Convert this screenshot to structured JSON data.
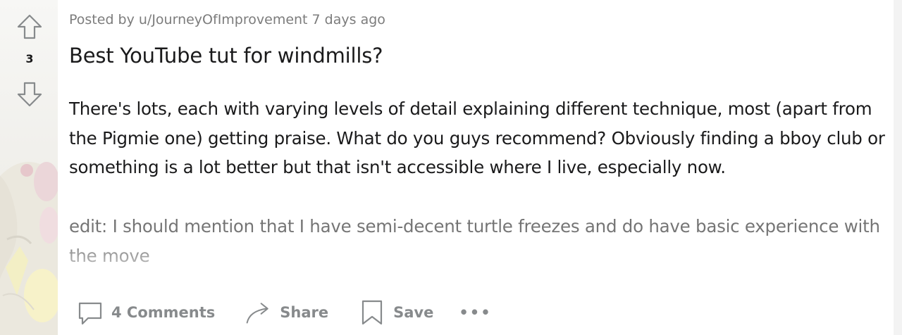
{
  "vote": {
    "score": "3",
    "upvote_icon": "arrow-up-outline-icon",
    "downvote_icon": "arrow-down-outline-icon"
  },
  "post": {
    "meta": "Posted by u/JourneyOfImprovement 7 days ago",
    "title": "Best YouTube tut for windmills?",
    "body": "There's lots, each with varying levels of detail explaining different technique, most (apart from the Pigmie one) getting praise. What do you guys recommend? Obviously finding a bboy club or something is a lot better but that isn't accessible where I live, especially now.",
    "edit": "edit: I should mention that I have semi-decent turtle freezes and do have basic experience with the move"
  },
  "actions": {
    "comments_label": "4 Comments",
    "share_label": "Share",
    "save_label": "Save",
    "more_label": "•••"
  },
  "colors": {
    "text_primary": "#1a1a1b",
    "text_meta": "#7c7c7c",
    "action_gray": "#878a8c"
  }
}
